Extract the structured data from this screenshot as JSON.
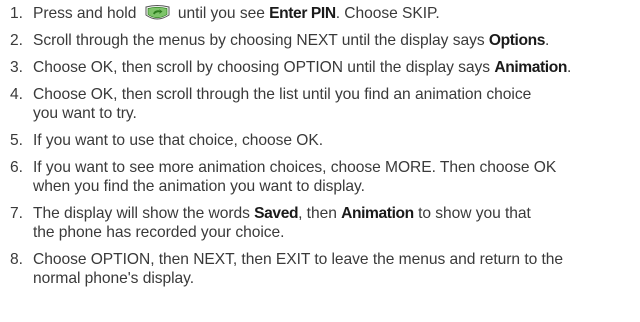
{
  "steps": [
    {
      "number": "1.",
      "a": "Press and hold",
      "icon": "phone-key-icon",
      "b": "until you see",
      "bold1": "Enter PIN",
      "c": ". Choose SKIP."
    },
    {
      "number": "2.",
      "a": "Scroll through the menus by choosing NEXT until the display says",
      "bold1": "Options",
      "c": "."
    },
    {
      "number": "3.",
      "a": "Choose OK, then scroll by choosing OPTION until the display says",
      "bold1": "Animation",
      "c": "."
    },
    {
      "number": "4.",
      "line1": "Choose OK, then scroll through the list until you find an animation choice",
      "line2": "you want to try."
    },
    {
      "number": "5.",
      "text": "If you want to use that choice, choose OK."
    },
    {
      "number": "6.",
      "line1": "If you want to see more animation choices, choose MORE. Then choose OK",
      "line2": "when you find the animation you want to display."
    },
    {
      "number": "7.",
      "a": "The display will show the words",
      "bold1": "Saved",
      "b": ", then",
      "bold2": "Animation",
      "c": "to show you that",
      "line2": "the phone has recorded your choice."
    },
    {
      "number": "8.",
      "line1": "Choose OPTION, then NEXT, then EXIT to leave the menus and return to the",
      "line2": "normal phone's display."
    }
  ],
  "colors": {
    "text": "#3a3a3a",
    "bold_text": "#1a1a1a",
    "icon_fill": "#7ec46a",
    "icon_arrow": "#2e7d1f"
  }
}
